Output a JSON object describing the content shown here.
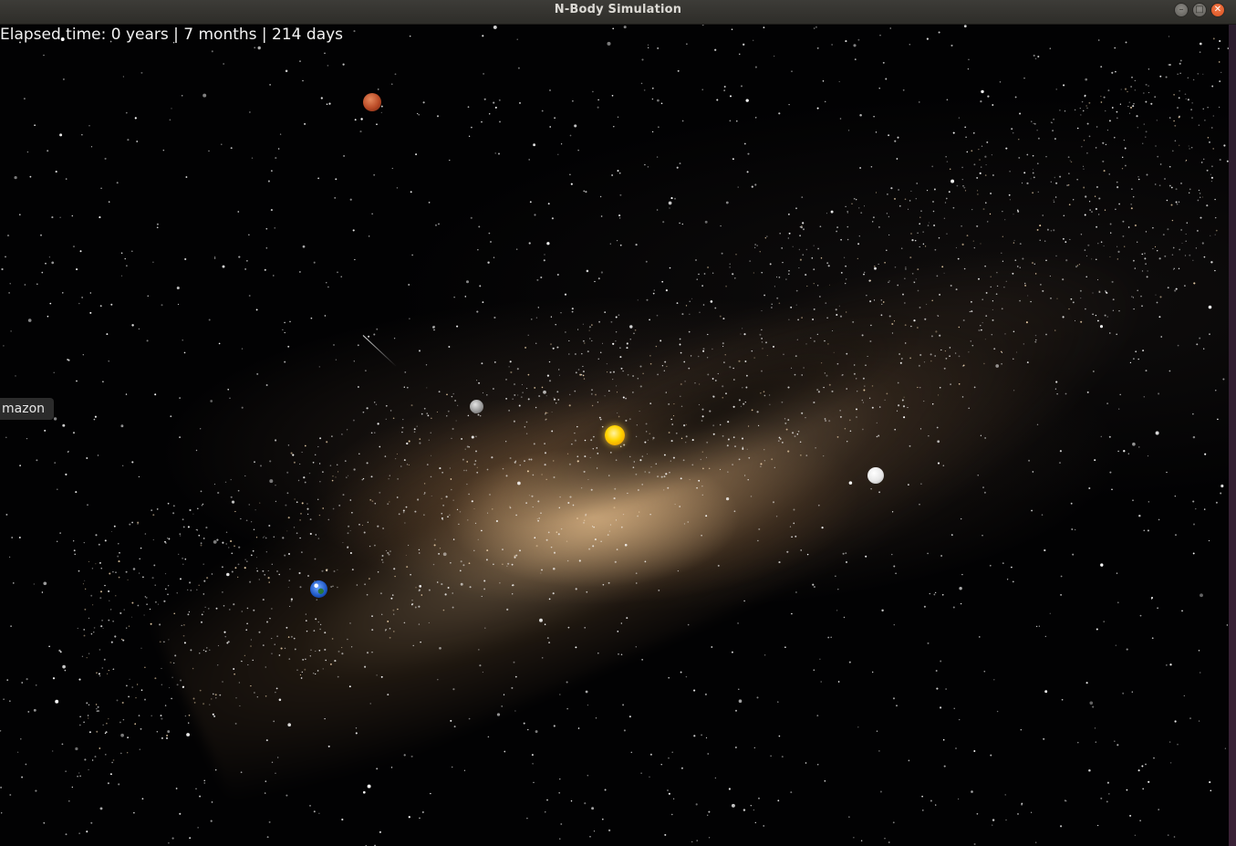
{
  "window": {
    "title": "N-Body Simulation"
  },
  "hud": {
    "elapsed_time": "Elapsed time: 0 years | 7 months | 214 days"
  },
  "tooltip": {
    "text": "mazon"
  },
  "bodies": [
    {
      "name": "sun",
      "icon": "sun-icon"
    },
    {
      "name": "mercury",
      "icon": "mercury-icon"
    },
    {
      "name": "venus",
      "icon": "venus-icon"
    },
    {
      "name": "earth",
      "icon": "earth-icon"
    },
    {
      "name": "mars",
      "icon": "mars-icon"
    }
  ],
  "icons": {
    "minimize": "minimize-icon",
    "maximize": "maximize-icon",
    "close": "close-icon"
  },
  "colors": {
    "titlebar": "#3d3c38",
    "close_button": "#e95420",
    "hud_text": "#f2f2f2",
    "sun": "#ffd400",
    "mars": "#b94a26",
    "earth": "#1c56c4",
    "venus": "#e6e6e6",
    "mercury": "#9a9a9a"
  }
}
